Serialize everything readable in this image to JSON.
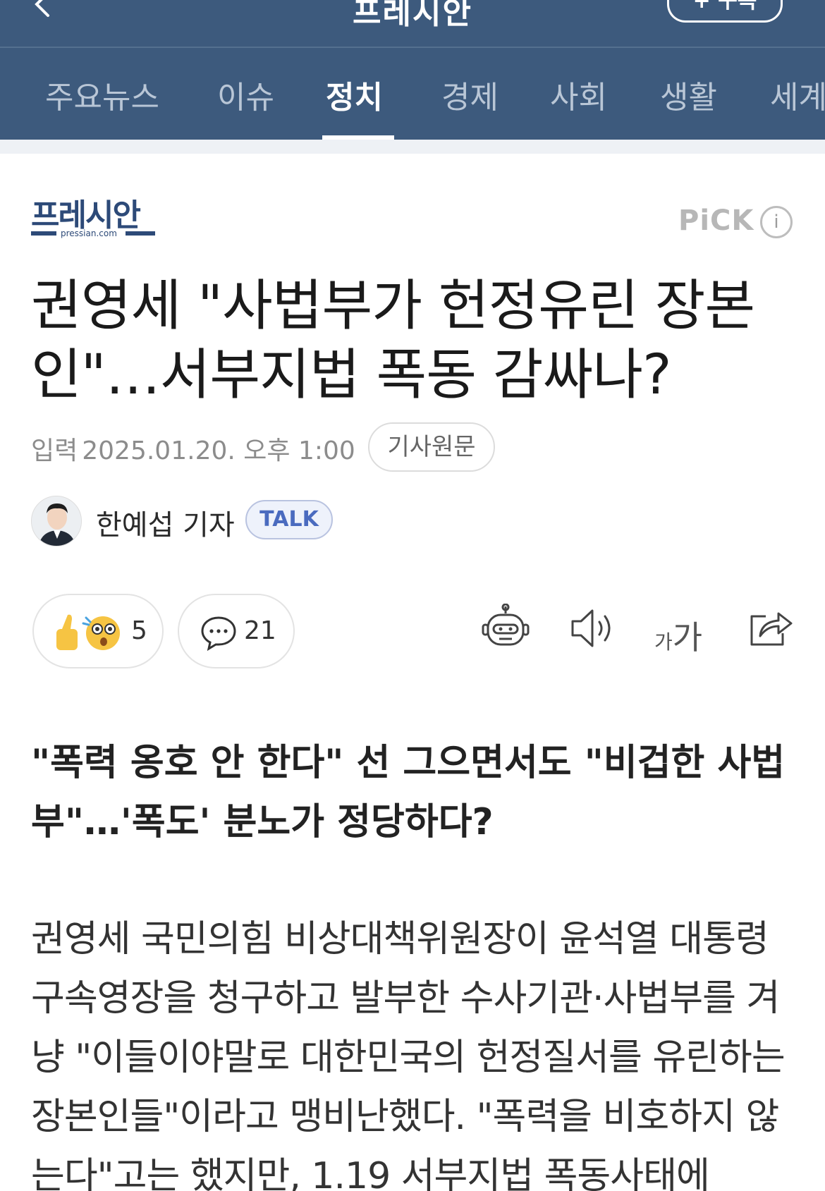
{
  "topbar": {
    "brand": "프레시안",
    "subscribe_label": "+ 구독"
  },
  "tabs": [
    {
      "label": "주요뉴스",
      "active": false
    },
    {
      "label": "이슈",
      "active": false
    },
    {
      "label": "정치",
      "active": true
    },
    {
      "label": "경제",
      "active": false
    },
    {
      "label": "사회",
      "active": false
    },
    {
      "label": "생활",
      "active": false
    },
    {
      "label": "세계",
      "active": false
    }
  ],
  "press": {
    "logo_text": "프레시안",
    "logo_sub": "pressian.com",
    "pick_label": "PiCK",
    "info_label": "i"
  },
  "article": {
    "headline": "권영세 \"사법부가 헌정유린 장본인\"…서부지법 폭동 감싸나?",
    "date_label": "입력",
    "date": "2025.01.20. 오후 1:00",
    "original_label": "기사원문",
    "reporter": "한예섭 기자",
    "talk_label": "TALK",
    "reaction_count": "5",
    "comment_count": "21",
    "font_size_small": "가",
    "font_size_big": "가",
    "subhead": "\"폭력 옹호 안 한다\" 선 그으면서도 \"비겁한 사법부\"…'폭도' 분노가 정당하다?",
    "body": "권영세 국민의힘 비상대책위원장이 윤석열 대통령 구속영장을 청구하고 발부한 수사기관·사법부를 겨냥 \"이들이야말로 대한민국의 헌정질서를 유린하는 장본인들\"이라고 맹비난했다. \"폭력을 비호하지 않는다\"고는 했지만, 1.19 서부지법 폭동사태에"
  },
  "colors": {
    "header_bg": "#3d5a7d",
    "accent": "#4a6bbf",
    "logo": "#2d4a78"
  },
  "icons": [
    "back-icon",
    "info-icon",
    "reaction-icons",
    "comment-icon",
    "ai-summary-icon",
    "audio-icon",
    "font-size-icon",
    "share-icon"
  ]
}
